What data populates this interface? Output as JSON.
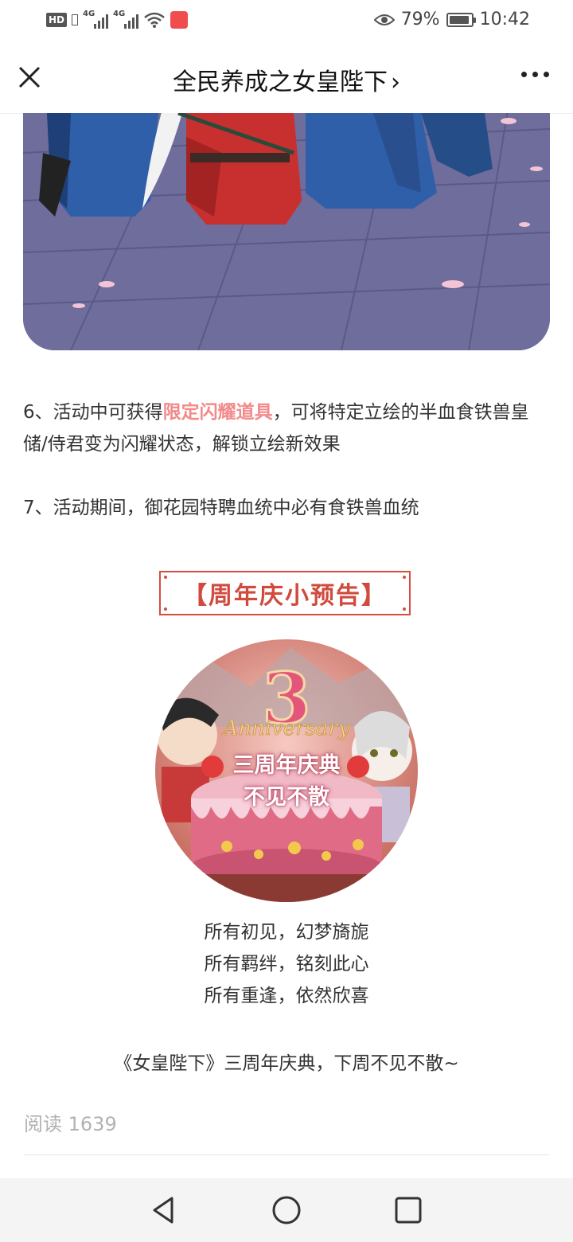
{
  "status_bar": {
    "hd": "HD",
    "signal_1_label": "4G",
    "signal_2_label": "4G",
    "battery_percent": "79%",
    "time": "10:42",
    "icons": [
      "eye-icon",
      "battery-icon",
      "wifi-icon",
      "gift-icon"
    ]
  },
  "title_bar": {
    "title": "全民养成之女皇陛下",
    "title_chevron": "›"
  },
  "article": {
    "item6_prefix": "6、活动中可获得",
    "item6_highlight": "限定闪耀道具",
    "item6_suffix": "，可将特定立绘的半血食铁兽皇储/侍君变为闪耀状态，解锁立绘新效果",
    "item7": "7、活动期间，御花园特聘血统中必有食铁兽血统",
    "preview_heading": "【周年庆小预告】",
    "image_caption_line1": "三周年庆典",
    "image_caption_line2": "不见不散",
    "image_number": "3",
    "image_word": "Anniversary",
    "poem": [
      "所有初见，幻梦旖旎",
      "所有羁绊，铭刻此心",
      "所有重逢，依然欣喜"
    ],
    "closing": "《女皇陛下》三周年庆典，下周不见不散~",
    "read_label": "阅读",
    "read_count": "1639"
  },
  "colors": {
    "highlight": "#f28a8a",
    "heading_red": "#d04a3e",
    "banner_floor": "#6f6e9e"
  },
  "nav_bar": {
    "icons": [
      "back-triangle-icon",
      "home-circle-icon",
      "recents-square-icon"
    ]
  }
}
